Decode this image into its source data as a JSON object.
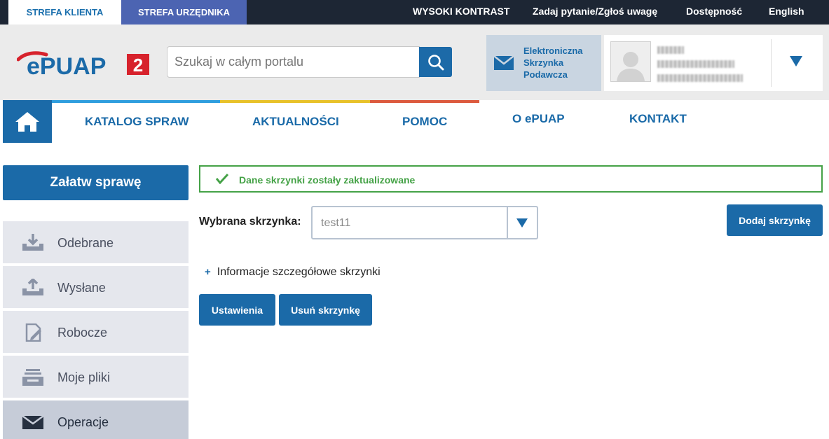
{
  "topbar": {
    "zone_client": "STREFA KLIENTA",
    "zone_official": "STREFA URZĘDNIKA",
    "links": [
      "WYSOKI KONTRAST",
      "Zadaj pytanie/Zgłoś uwagę",
      "Dostępność",
      "English"
    ]
  },
  "header": {
    "logo_text": "ePUAP",
    "logo_badge": "2",
    "search_placeholder": "Szukaj w całym portalu",
    "esp_label": "Elektroniczna Skrzynka Podawcza"
  },
  "nav": {
    "items": [
      "KATALOG SPRAW",
      "AKTUALNOŚCI",
      "POMOC",
      "O ePUAP",
      "KONTAKT"
    ]
  },
  "sidebar": {
    "primary_button": "Załatw sprawę",
    "items": [
      {
        "label": "Odebrane",
        "icon": "download-tray-icon"
      },
      {
        "label": "Wysłane",
        "icon": "upload-tray-icon"
      },
      {
        "label": "Robocze",
        "icon": "document-edit-icon"
      },
      {
        "label": "Moje pliki",
        "icon": "file-tray-icon"
      },
      {
        "label": "Operacje",
        "icon": "envelope-icon"
      }
    ]
  },
  "main": {
    "alert": "Dane skrzynki zostały zaktualizowane",
    "mailbox_label": "Wybrana skrzynka:",
    "mailbox_value": "test11",
    "add_button": "Dodaj skrzynkę",
    "details_link": "Informacje szczegółowe skrzynki",
    "settings_button": "Ustawienia",
    "delete_button": "Usuń skrzynkę"
  },
  "colors": {
    "primary": "#1b6aa8",
    "success": "#45a247",
    "nav_strip_blue": "#2f9ede",
    "nav_strip_yellow": "#e8c22a",
    "nav_strip_red": "#dc5a3e",
    "logo_red": "#d7222c"
  }
}
